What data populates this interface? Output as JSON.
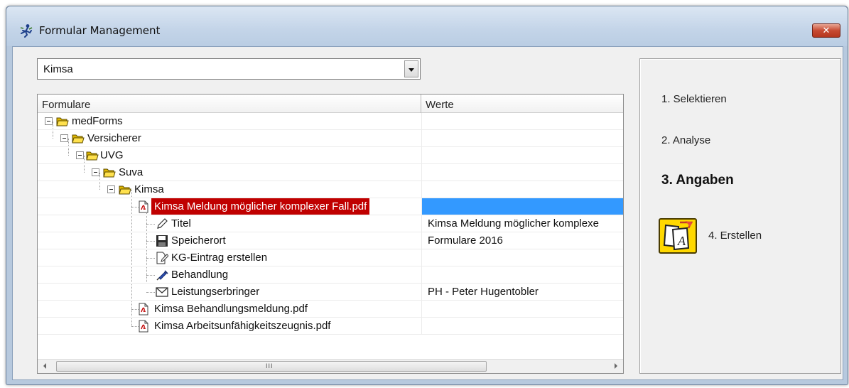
{
  "window": {
    "title": "Formular Management",
    "close_glyph": "✕"
  },
  "selector": {
    "selected": "Kimsa"
  },
  "grid": {
    "columns": [
      "Formulare",
      "Werte"
    ],
    "rows": [
      {
        "label": "medForms",
        "value": ""
      },
      {
        "label": "Versicherer",
        "value": ""
      },
      {
        "label": "UVG",
        "value": ""
      },
      {
        "label": "Suva",
        "value": ""
      },
      {
        "label": "Kimsa",
        "value": ""
      },
      {
        "label": "Kimsa Meldung möglicher komplexer Fall.pdf",
        "value": ""
      },
      {
        "label": "Titel",
        "value": "Kimsa Meldung möglicher komplexe"
      },
      {
        "label": "Speicherort",
        "value": "Formulare 2016"
      },
      {
        "label": "KG-Eintrag erstellen",
        "value": ""
      },
      {
        "label": "Behandlung",
        "value": ""
      },
      {
        "label": "Leistungserbringer",
        "value": "PH - Peter Hugentobler"
      },
      {
        "label": "Kimsa Behandlungsmeldung.pdf",
        "value": ""
      },
      {
        "label": "Kimsa Arbeitsunfähigkeitszeugnis.pdf",
        "value": ""
      }
    ],
    "scroll_grip": "III"
  },
  "steps": {
    "s1": "1. Selektieren",
    "s2": "2. Analyse",
    "s3": "3. Angaben",
    "s4": "4. Erstellen"
  },
  "colors": {
    "selection_red": "#c00000",
    "selection_blue": "#3399ff",
    "button_yellow": "#ffd800"
  }
}
